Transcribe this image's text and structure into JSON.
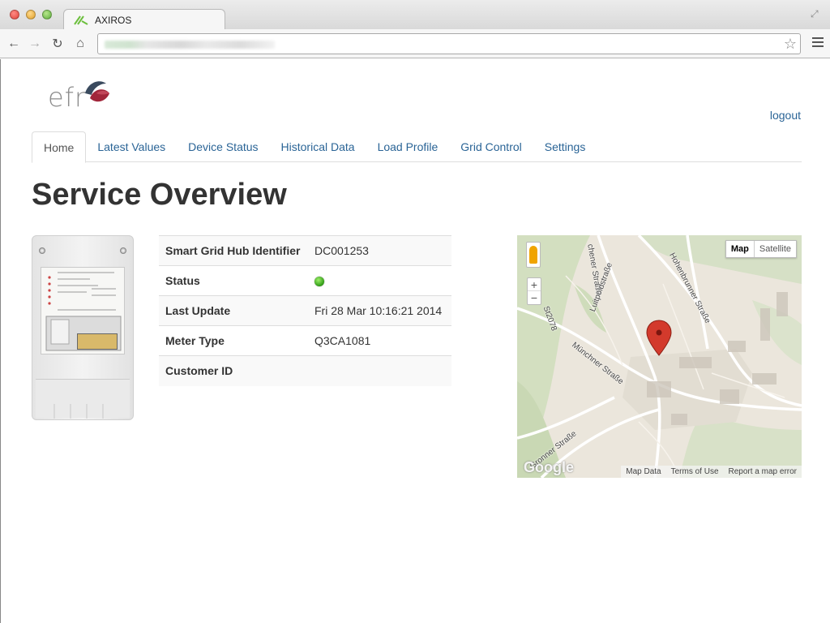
{
  "browser": {
    "tab_title": "AXIROS"
  },
  "header": {
    "logo_text": "efr",
    "logout_label": "logout"
  },
  "nav": {
    "tabs": [
      {
        "label": "Home",
        "active": true
      },
      {
        "label": "Latest Values",
        "active": false
      },
      {
        "label": "Device Status",
        "active": false
      },
      {
        "label": "Historical Data",
        "active": false
      },
      {
        "label": "Load Profile",
        "active": false
      },
      {
        "label": "Grid Control",
        "active": false
      },
      {
        "label": "Settings",
        "active": false
      }
    ]
  },
  "main": {
    "title": "Service Overview",
    "info": [
      {
        "key": "Smart Grid Hub Identifier",
        "value": "DC001253"
      },
      {
        "key": "Status",
        "value": "",
        "status": "online"
      },
      {
        "key": "Last Update",
        "value": "Fri 28 Mar 10:16:21 2014"
      },
      {
        "key": "Meter Type",
        "value": "Q3CA1081"
      },
      {
        "key": "Customer ID",
        "value": ""
      }
    ]
  },
  "map": {
    "type_map": "Map",
    "type_satellite": "Satellite",
    "zoom_in": "+",
    "zoom_out": "−",
    "logo": "Google",
    "footer": [
      "Map Data",
      "Terms of Use",
      "Report a map error"
    ],
    "streets": [
      "Luitpoldstraße",
      "Hohenbrunner Straße",
      "Münchner Straße",
      "St2078",
      "Gronner Straße",
      "chener Straße"
    ]
  },
  "colors": {
    "link": "#2a6496",
    "status_online": "#3fae1e",
    "map_marker": "#d33a2c"
  }
}
